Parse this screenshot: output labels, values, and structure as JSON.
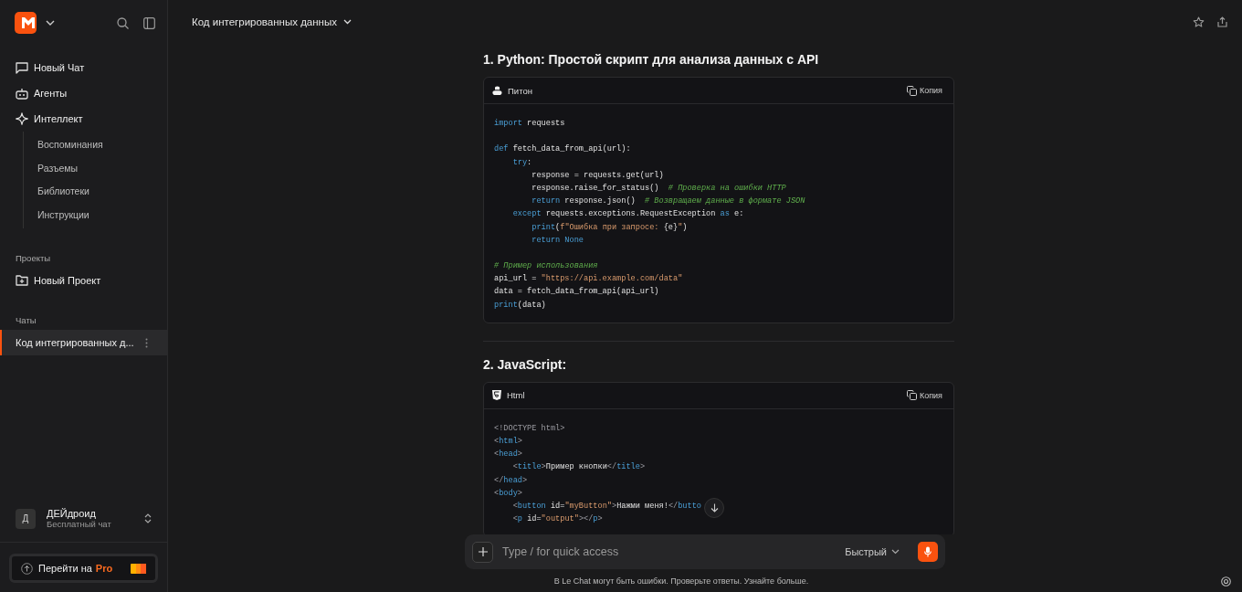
{
  "sidebar": {
    "nav": [
      {
        "label": "Новый Чат"
      },
      {
        "label": "Агенты"
      },
      {
        "label": "Интеллект",
        "children": [
          {
            "label": "Воспоминания"
          },
          {
            "label": "Разъемы"
          },
          {
            "label": "Библиотеки"
          },
          {
            "label": "Инструкции"
          }
        ]
      }
    ],
    "projects": {
      "heading": "Проекты",
      "items": [
        {
          "label": "Новый Проект"
        }
      ]
    },
    "chats": {
      "heading": "Чаты",
      "items": [
        {
          "label": "Код интегрированных д...",
          "selected": true
        }
      ]
    },
    "user": {
      "avatar": "Д",
      "name": "ДЕЙдроид",
      "plan": "Бесплатный чат"
    },
    "upgrade": {
      "label": "Перейти на",
      "highlight": "Pro"
    }
  },
  "header": {
    "title": "Код интегрированных данных"
  },
  "sections": [
    {
      "heading": "1. Python: Простой скрипт для анализа данных с API",
      "language": "Питон",
      "copy": "Копия",
      "lines": [
        {
          "kind": "code",
          "tokens": [
            {
              "kind": "kw",
              "text": "import"
            },
            {
              "kind": "pl",
              "text": " requests"
            }
          ]
        },
        {
          "kind": "blank"
        },
        {
          "kind": "code",
          "tokens": [
            {
              "kind": "kw",
              "text": "def"
            },
            {
              "kind": "pl",
              "text": " fetch_data_from_api(url):"
            }
          ]
        },
        {
          "kind": "code",
          "tokens": [
            {
              "kind": "kw",
              "text": "    try"
            },
            {
              "kind": "pl",
              "text": ":"
            }
          ]
        },
        {
          "kind": "code",
          "tokens": [
            {
              "kind": "pl",
              "text": "        response = requests.get(url)"
            }
          ]
        },
        {
          "kind": "code",
          "tokens": [
            {
              "kind": "pl",
              "text": "        response.raise_for_status()  "
            },
            {
              "kind": "cm",
              "text": "# Проверка на ошибки HTTP"
            }
          ]
        },
        {
          "kind": "code",
          "tokens": [
            {
              "kind": "kw",
              "text": "        return"
            },
            {
              "kind": "pl",
              "text": " response.json()  "
            },
            {
              "kind": "cm",
              "text": "# Возвращаем данные в формате JSON"
            }
          ]
        },
        {
          "kind": "code",
          "tokens": [
            {
              "kind": "kw",
              "text": "    except"
            },
            {
              "kind": "pl",
              "text": " requests.exceptions.RequestException "
            },
            {
              "kind": "kw",
              "text": "as"
            },
            {
              "kind": "pl",
              "text": " e:"
            }
          ]
        },
        {
          "kind": "code",
          "tokens": [
            {
              "kind": "kw",
              "text": "        print"
            },
            {
              "kind": "pl",
              "text": "("
            },
            {
              "kind": "st",
              "text": "f\"Ошибка при запросе: "
            },
            {
              "kind": "pl",
              "text": "{e}"
            },
            {
              "kind": "st",
              "text": "\""
            },
            {
              "kind": "pl",
              "text": ")"
            }
          ]
        },
        {
          "kind": "code",
          "tokens": [
            {
              "kind": "kw",
              "text": "        return None"
            }
          ]
        },
        {
          "kind": "blank"
        },
        {
          "kind": "code",
          "tokens": [
            {
              "kind": "cm",
              "text": "# Пример использования"
            }
          ]
        },
        {
          "kind": "code",
          "tokens": [
            {
              "kind": "pl",
              "text": "api_url = "
            },
            {
              "kind": "st",
              "text": "\"https://api.example.com/data\""
            }
          ]
        },
        {
          "kind": "code",
          "tokens": [
            {
              "kind": "pl",
              "text": "data = fetch_data_from_api(api_url)"
            }
          ]
        },
        {
          "kind": "code",
          "tokens": [
            {
              "kind": "kw",
              "text": "print"
            },
            {
              "kind": "pl",
              "text": "(data)"
            }
          ]
        }
      ]
    },
    {
      "heading": "2. JavaScript:",
      "language": "Html",
      "copy": "Копия",
      "lines": [
        {
          "kind": "code",
          "tokens": [
            {
              "kind": "pn",
              "text": "<!DOCTYPE html>"
            }
          ]
        },
        {
          "kind": "code",
          "tokens": [
            {
              "kind": "pn",
              "text": "<"
            },
            {
              "kind": "kw",
              "text": "html"
            },
            {
              "kind": "pn",
              "text": ">"
            }
          ]
        },
        {
          "kind": "code",
          "tokens": [
            {
              "kind": "pn",
              "text": "<"
            },
            {
              "kind": "kw",
              "text": "head"
            },
            {
              "kind": "pn",
              "text": ">"
            }
          ]
        },
        {
          "kind": "code",
          "tokens": [
            {
              "kind": "pn",
              "text": "    <"
            },
            {
              "kind": "kw",
              "text": "title"
            },
            {
              "kind": "pn",
              "text": ">"
            },
            {
              "kind": "pl",
              "text": "Пример кнопки"
            },
            {
              "kind": "pn",
              "text": "</"
            },
            {
              "kind": "kw",
              "text": "title"
            },
            {
              "kind": "pn",
              "text": ">"
            }
          ]
        },
        {
          "kind": "code",
          "tokens": [
            {
              "kind": "pn",
              "text": "</"
            },
            {
              "kind": "kw",
              "text": "head"
            },
            {
              "kind": "pn",
              "text": ">"
            }
          ]
        },
        {
          "kind": "code",
          "tokens": [
            {
              "kind": "pn",
              "text": "<"
            },
            {
              "kind": "kw",
              "text": "body"
            },
            {
              "kind": "pn",
              "text": ">"
            }
          ]
        },
        {
          "kind": "code",
          "tokens": [
            {
              "kind": "pn",
              "text": "    <"
            },
            {
              "kind": "kw",
              "text": "button"
            },
            {
              "kind": "pl",
              "text": " id="
            },
            {
              "kind": "st",
              "text": "\"myButton\""
            },
            {
              "kind": "pn",
              "text": ">"
            },
            {
              "kind": "pl",
              "text": "Нажми меня!"
            },
            {
              "kind": "pn",
              "text": "</"
            },
            {
              "kind": "kw",
              "text": "butto"
            }
          ]
        },
        {
          "kind": "code",
          "tokens": [
            {
              "kind": "pn",
              "text": "    <"
            },
            {
              "kind": "kw",
              "text": "p"
            },
            {
              "kind": "pl",
              "text": " id="
            },
            {
              "kind": "st",
              "text": "\"output\""
            },
            {
              "kind": "pn",
              "text": "></"
            },
            {
              "kind": "kw",
              "text": "p"
            },
            {
              "kind": "pn",
              "text": ">"
            }
          ]
        }
      ]
    }
  ],
  "composer": {
    "placeholder": "Type / for quick access",
    "mode": "Быстрый"
  },
  "footer": "В Le Chat могут быть ошибки. Проверьте ответы. Узнайте больше."
}
